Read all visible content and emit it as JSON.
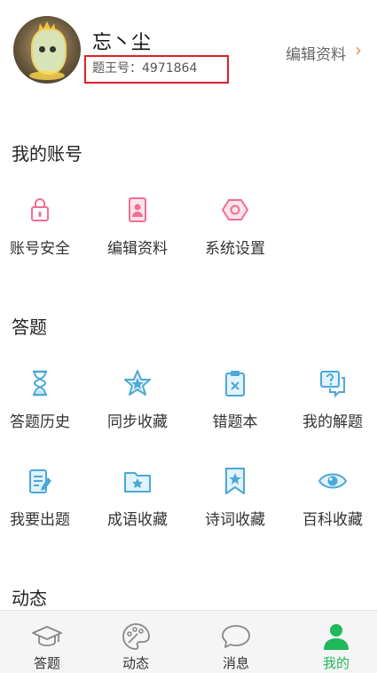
{
  "profile": {
    "username": "忘丶尘",
    "uid_text": "题王号：4971864",
    "edit_label": "编辑资料",
    "edit_arrow": "›"
  },
  "account": {
    "title": "我的账号",
    "items": [
      {
        "label": "账号安全",
        "icon": "lock-icon"
      },
      {
        "label": "编辑资料",
        "icon": "profile-card-icon"
      },
      {
        "label": "系统设置",
        "icon": "settings-hexagon-icon"
      }
    ]
  },
  "answer": {
    "title": "答题",
    "items": [
      {
        "label": "答题历史",
        "icon": "hourglass-icon"
      },
      {
        "label": "同步收藏",
        "icon": "star-icon"
      },
      {
        "label": "错题本",
        "icon": "clipboard-x-icon"
      },
      {
        "label": "我的解题",
        "icon": "question-chat-icon"
      },
      {
        "label": "我要出题",
        "icon": "edit-document-icon"
      },
      {
        "label": "成语收藏",
        "icon": "star-folder-icon"
      },
      {
        "label": "诗词收藏",
        "icon": "bookmark-star-icon"
      },
      {
        "label": "百科收藏",
        "icon": "eye-icon"
      }
    ]
  },
  "dynamics": {
    "title": "动态"
  },
  "tabbar": {
    "tabs": [
      {
        "label": "答题",
        "icon": "graduation-cap-icon"
      },
      {
        "label": "动态",
        "icon": "palette-icon"
      },
      {
        "label": "消息",
        "icon": "chat-bubble-icon"
      },
      {
        "label": "我的",
        "icon": "person-icon"
      }
    ],
    "active_color": "#1fb85a"
  },
  "colors": {
    "account_icon": "#ef6f94",
    "answer_icon": "#4ba8d8",
    "highlight_box": "#d9232a"
  }
}
